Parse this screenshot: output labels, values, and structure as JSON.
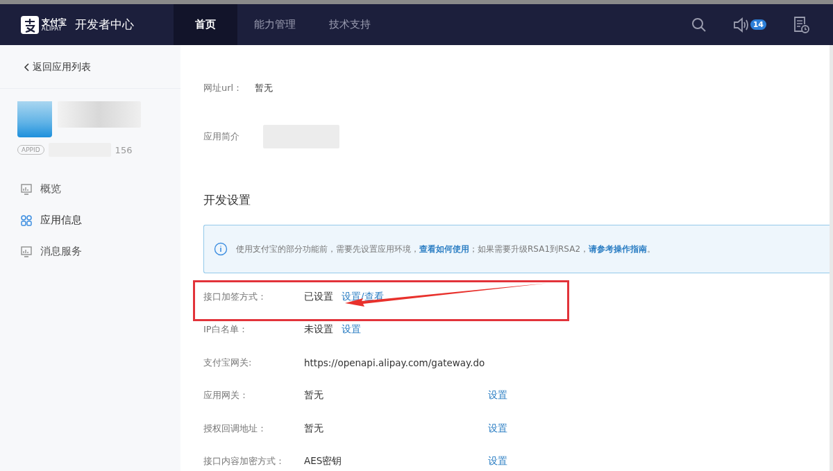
{
  "header": {
    "logo_cn": "支付宝",
    "logo_en": "ALIPAY",
    "title": "开发者中心",
    "tabs": [
      {
        "label": "首页",
        "selected": true
      },
      {
        "label": "能力管理",
        "selected": false
      },
      {
        "label": "技术支持",
        "selected": false
      }
    ],
    "badge": "14"
  },
  "sidebar": {
    "back": "返回应用列表",
    "appid_tag": "APPID",
    "appid_suffix": "156",
    "items": [
      {
        "label": "概览",
        "selected": false
      },
      {
        "label": "应用信息",
        "selected": true
      },
      {
        "label": "消息服务",
        "selected": false
      }
    ]
  },
  "basic": [
    {
      "label": "网址url：",
      "value": "暂无",
      "kind": "text"
    },
    {
      "label": "应用简介",
      "kind": "blurred"
    }
  ],
  "section_title": "开发设置",
  "notice": {
    "text": "使用支付宝的部分功能前，需要先设置应用环境，",
    "link1": "查看如何使用",
    "middle": "；如果需要升级RSA1到RSA2，",
    "link2": "请参考操作指南",
    "end": "。"
  },
  "settings": [
    {
      "label": "接口加签方式：",
      "value": "已设置",
      "link": "设置/查看",
      "kind": "inline"
    },
    {
      "label": "IP白名单：",
      "value": "未设置",
      "link": "设置",
      "kind": "inline"
    },
    {
      "label": "支付宝网关:",
      "value": "https://openapi.alipay.com/gateway.do",
      "kind": "plain"
    },
    {
      "label": "应用网关：",
      "value": "暂无",
      "link": "设置",
      "kind": "right"
    },
    {
      "label": "授权回调地址：",
      "value": "暂无",
      "link": "设置",
      "kind": "right"
    },
    {
      "label": "接口内容加密方式：",
      "value": "AES密钥",
      "link": "设置",
      "kind": "right"
    }
  ]
}
